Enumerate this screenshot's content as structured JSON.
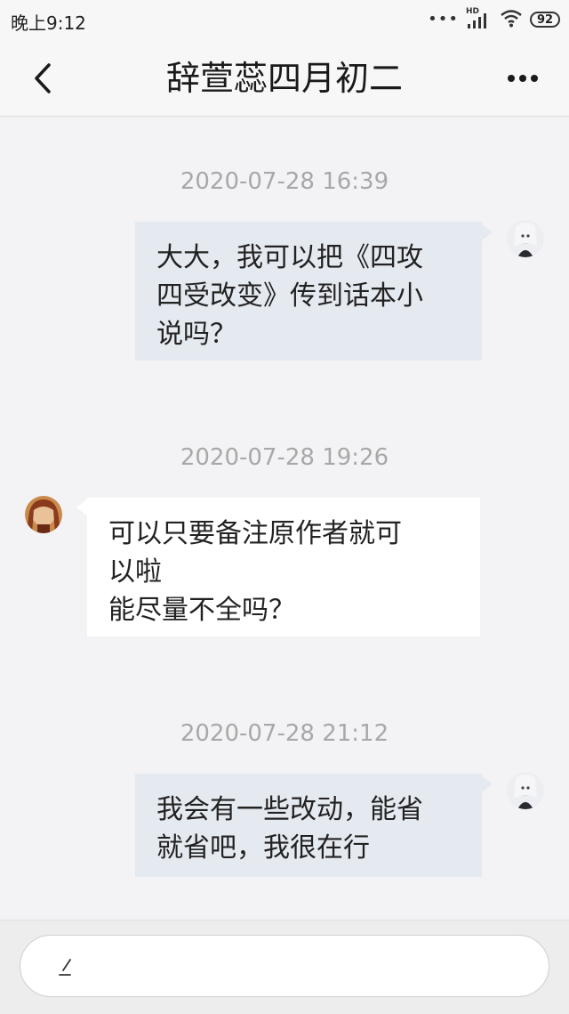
{
  "status_bar": {
    "time": "晚上9:12",
    "network_label": "HD",
    "battery": "92",
    "icons": [
      "more-dots-icon",
      "signal-icon",
      "wifi-icon",
      "battery-icon"
    ]
  },
  "header": {
    "title": "辞萱蕊四月初二",
    "back_icon": "chevron-left-icon",
    "more_icon": "more-horizontal-icon"
  },
  "messages": [
    {
      "timestamp": "2020-07-28 16:39",
      "direction": "outgoing",
      "text": "大大，我可以把《四攻\n四受改变》传到话本小\n说吗？"
    },
    {
      "timestamp": "2020-07-28 19:26",
      "direction": "incoming",
      "text": "可以只要备注原作者就可\n以啦\n能尽量不全吗？"
    },
    {
      "timestamp": "2020-07-28 21:12",
      "direction": "outgoing",
      "text": "我会有一些改动，能省\n就省吧，我很在行"
    }
  ],
  "input": {
    "icon": "pen-icon"
  },
  "colors": {
    "background": "#f3f3f5",
    "outgoing_bubble": "#e5e9f0",
    "incoming_bubble": "#ffffff",
    "timestamp_text": "#a8a8a8"
  }
}
